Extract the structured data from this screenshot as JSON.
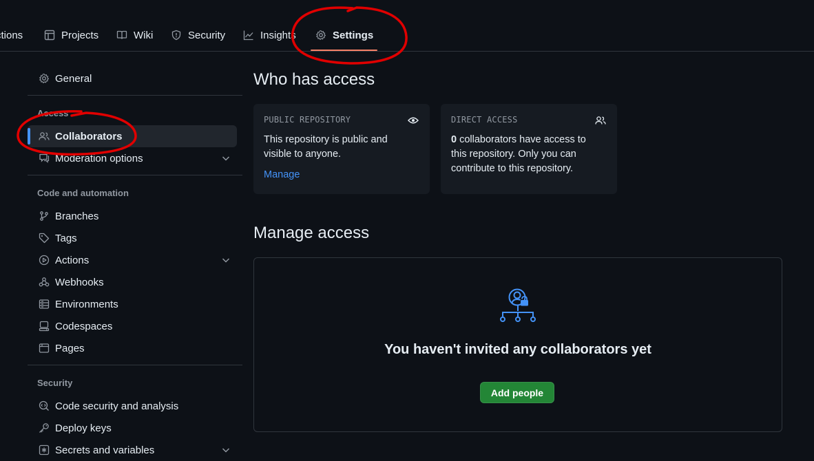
{
  "topnav": {
    "tabs": [
      {
        "label": "ctions",
        "icon": "actions-icon"
      },
      {
        "label": "Projects",
        "icon": "table-icon"
      },
      {
        "label": "Wiki",
        "icon": "book-icon"
      },
      {
        "label": "Security",
        "icon": "shield-icon"
      },
      {
        "label": "Insights",
        "icon": "graph-icon"
      },
      {
        "label": "Settings",
        "icon": "gear-icon",
        "active": true
      }
    ]
  },
  "sidebar": {
    "general": "General",
    "access_heading": "Access",
    "collaborators": "Collaborators",
    "moderation": "Moderation options",
    "code_heading": "Code and automation",
    "branches": "Branches",
    "tags": "Tags",
    "actions": "Actions",
    "webhooks": "Webhooks",
    "environments": "Environments",
    "codespaces": "Codespaces",
    "pages": "Pages",
    "security_heading": "Security",
    "code_security": "Code security and analysis",
    "deploy_keys": "Deploy keys",
    "secrets": "Secrets and variables"
  },
  "main": {
    "who_title": "Who has access",
    "public_card": {
      "title": "PUBLIC REPOSITORY",
      "text": "This repository is public and visible to anyone.",
      "link": "Manage"
    },
    "direct_card": {
      "title": "DIRECT ACCESS",
      "count": "0",
      "text": " collaborators have access to this repository. Only you can contribute to this repository."
    },
    "manage_title": "Manage access",
    "empty_title": "You haven't invited any collaborators yet",
    "add_button": "Add people"
  },
  "colors": {
    "background": "#0d1117",
    "accent_blue": "#4493f8",
    "primary_green": "#238636",
    "tab_underline": "#f78166",
    "annotation_red": "#e00000"
  }
}
